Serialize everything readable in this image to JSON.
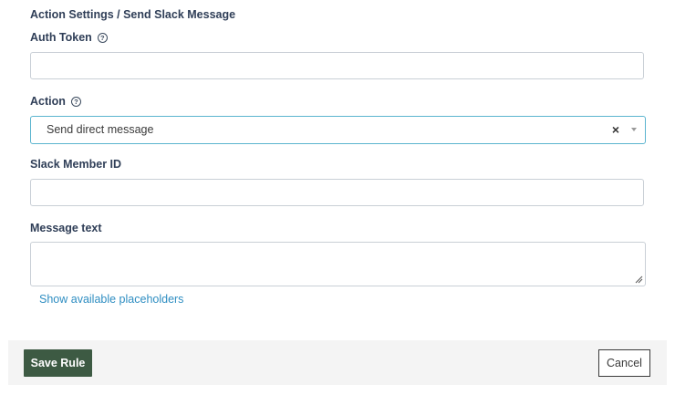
{
  "header": {
    "title": "Action Settings / Send Slack Message"
  },
  "fields": {
    "auth_token": {
      "label": "Auth Token",
      "value": ""
    },
    "action": {
      "label": "Action",
      "selected": "Send direct message",
      "clear_symbol": "×"
    },
    "slack_member_id": {
      "label": "Slack Member ID",
      "value": ""
    },
    "message_text": {
      "label": "Message text",
      "value": ""
    }
  },
  "placeholders_link": "Show available placeholders",
  "footer": {
    "save_label": "Save Rule",
    "cancel_label": "Cancel"
  },
  "colors": {
    "primary_button": "#3d5a43",
    "focus_border": "#5bb4cf",
    "link": "#2f8ec2"
  }
}
